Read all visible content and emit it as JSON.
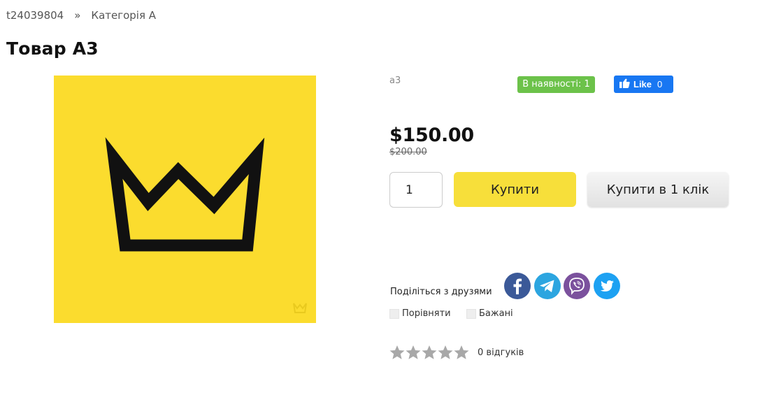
{
  "breadcrumb": {
    "items": [
      "t24039804",
      "Категорія А"
    ],
    "separator": "»"
  },
  "product": {
    "title": "Товар А3",
    "sku": "а3",
    "stock_label": "В наявності: 1",
    "price": "$150.00",
    "old_price": "$200.00",
    "quantity": "1",
    "image_icon": "crown-logo",
    "image_color": "#fbdc2e"
  },
  "facebook": {
    "like_label": "Like",
    "like_count": "0",
    "color": "#1877f2"
  },
  "actions": {
    "buy_label": "Купити",
    "one_click_label": "Купити в 1 клік",
    "buy_color": "#f7df3a"
  },
  "share": {
    "label": "Поділіться з друзями",
    "networks": [
      {
        "name": "facebook",
        "icon": "facebook-icon",
        "color": "#3b5998"
      },
      {
        "name": "telegram",
        "icon": "telegram-icon",
        "color": "#2ca5e0"
      },
      {
        "name": "viber",
        "icon": "viber-icon",
        "color": "#7b519d"
      },
      {
        "name": "twitter",
        "icon": "twitter-icon",
        "color": "#1da1f2"
      }
    ]
  },
  "extras": {
    "compare_label": "Порівняти",
    "wishlist_label": "Бажані"
  },
  "rating": {
    "stars_filled": 0,
    "stars_total": 5,
    "reviews_label": "0 відгуків"
  }
}
